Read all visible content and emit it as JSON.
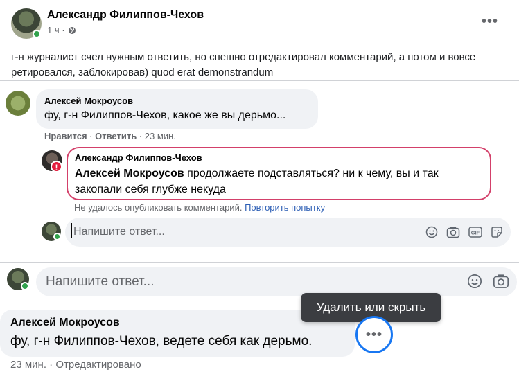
{
  "post": {
    "author": "Александр Филиппов-Чехов",
    "time": "1 ч ·",
    "more": "•••",
    "text": "г-н журналист счел нужным ответить, но спешно отредактировал комментарий, а потом и вовсе ретировался, заблокировав) quod erat demonstrandum"
  },
  "comment1": {
    "author": "Алексей Мокроусов",
    "text": "фу, г-н Филиппов-Чехов, какое же вы дерьмо...",
    "like": "Нравится",
    "dot1": " · ",
    "reply": "Ответить",
    "dot2": " · ",
    "time": "23 мин."
  },
  "failed_reply": {
    "author": "Александр Филиппов-Чехов",
    "mention": "Алексей Мокроусов",
    "text": " продолжаете подставляться? ни к чему, вы и так закопали себя глубже некуда",
    "error_icon": "!",
    "error_text": "Не удалось опубликовать комментарий. ",
    "retry": "Повторить попытку"
  },
  "reply_input": {
    "placeholder": "Напишите ответ..."
  },
  "bottom_input": {
    "placeholder": "Напишите ответ..."
  },
  "comment2": {
    "author": "Алексей Мокроусов",
    "text": "фу, г-н Филиппов-Чехов, ведете себя как дерьмо.",
    "meta": "23 мин. · Отредактировано"
  },
  "tooltip": {
    "label": "Удалить или скрыть"
  },
  "more_button": {
    "label": "•••"
  },
  "colors": {
    "accent": "#1877f2",
    "error": "#e41e3f",
    "online": "#31a24c",
    "link": "#2d5fb5"
  }
}
